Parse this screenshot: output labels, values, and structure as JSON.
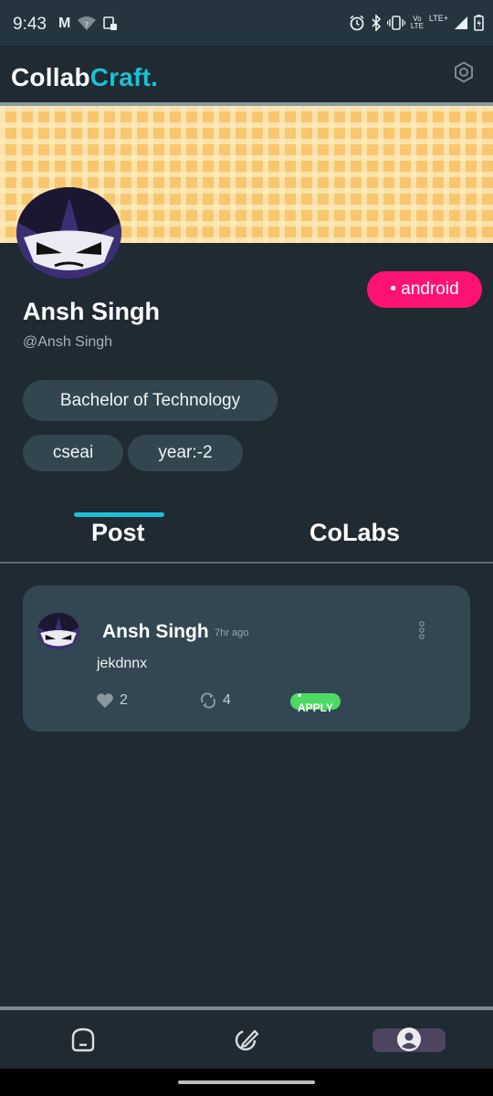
{
  "status_bar": {
    "time": "9:43",
    "left_icons": [
      "gmail-icon",
      "wifi-question-icon",
      "screenshot-icon"
    ],
    "right_icons": [
      "alarm-icon",
      "bluetooth-icon",
      "vibrate-icon",
      "volte-icon",
      "lte-plus-icon",
      "signal-icon",
      "battery-icon"
    ],
    "volte_label": "Vo",
    "lte_label": "LTE",
    "lte_plus_label": "LTE+"
  },
  "header": {
    "brand_part1": "Collab",
    "brand_part2": "Craft.",
    "brand_colors": {
      "primary": "#ffffff",
      "accent": "#19c2d6"
    }
  },
  "profile": {
    "name": "Ansh Singh",
    "handle": "@Ansh Singh",
    "badge": "• android",
    "degree": "Bachelor of Technology",
    "branch": "cseai",
    "year": "year:-2",
    "badge_color": "#ff1372"
  },
  "tabs": [
    {
      "label": "Post",
      "active": true
    },
    {
      "label": "CoLabs",
      "active": false
    }
  ],
  "posts": [
    {
      "author": "Ansh Singh",
      "time": "7hr ago",
      "body": "jekdnnx",
      "likes": "2",
      "reposts": "4",
      "tag": "• APPLY",
      "tag_color": "#4cd964"
    }
  ],
  "bottom_nav": {
    "items": [
      "home-icon",
      "edit-icon",
      "profile-icon"
    ],
    "active": "profile-icon"
  }
}
